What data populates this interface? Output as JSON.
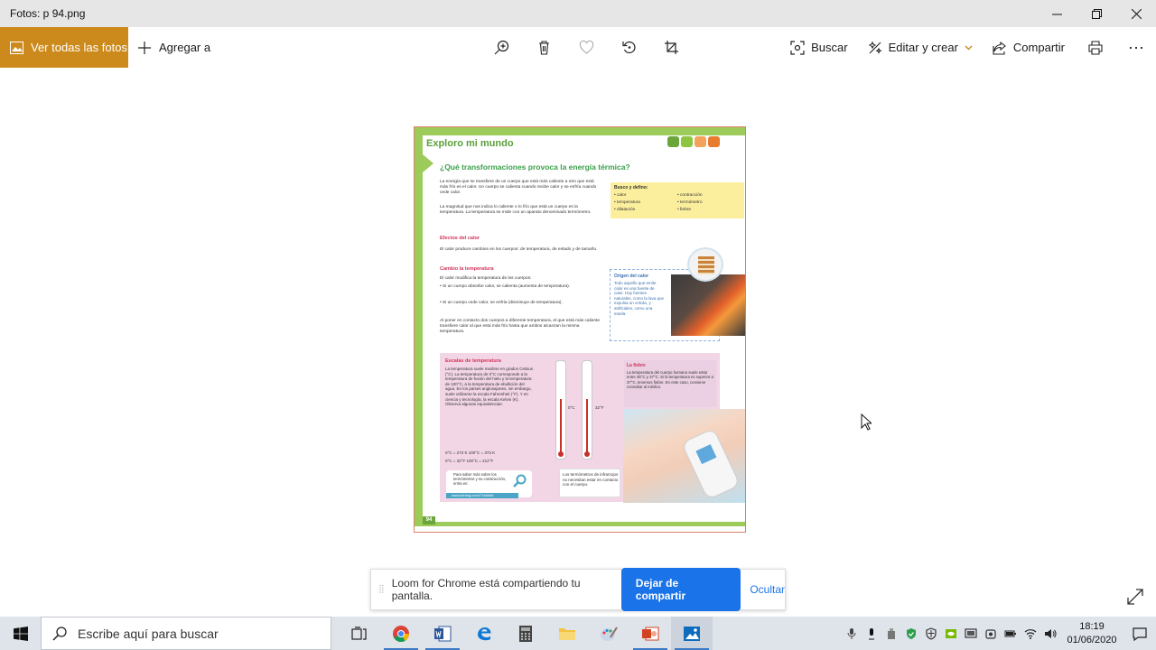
{
  "window": {
    "title": "Fotos: p 94.png"
  },
  "commandbar": {
    "view_all_label": "Ver todas las fotos",
    "add_to_label": "Agregar a",
    "search_label": "Buscar",
    "edit_create_label": "Editar y crear",
    "share_label": "Compartir"
  },
  "page": {
    "section_title": "Exploro mi mundo",
    "question": "¿Qué transformaciones provoca la energía térmica?",
    "intro_paragraph": "La energía que se transfiere de un cuerpo que está más caliente a otro que está más frío es el calor. Un cuerpo se calienta cuando recibe calor y se enfría cuando cede calor.",
    "temperature_paragraph": "La magnitud que nos indica lo caliente o lo frío que está un cuerpo es la temperatura. La temperatura se mide con un aparato denominado termómetro.",
    "effects_heading": "Efectos del calor",
    "effects_paragraph": "El calor produce cambios en los cuerpos: de temperatura, de estado y de tamaño.",
    "change_heading": "Cambio la temperatura",
    "change_paragraph": "El calor modifica la temperatura de los cuerpos:",
    "bullet_1": "• Si un cuerpo absorbe calor, se calienta (aumenta de temperatura).",
    "bullet_2": "• Si un cuerpo cede calor, se enfría (disminuye de temperatura).",
    "contact_paragraph": "Al poner en contacto dos cuerpos a diferente temperatura, el que está más caliente transfiere calor al que está más frío hasta que ambos alcanzan la misma temperatura.",
    "define_box_title": "Busco y defino:",
    "define_col1": [
      "• calor",
      "• temperatura",
      "• dilatación"
    ],
    "define_col2": [
      "• contracción",
      "• termómetro",
      "• fiebre"
    ],
    "origin_title": "Origen del calor",
    "origin_text": "Todo aquello que emite calor es una fuente de calor. Hay fuentes naturales, como la lava que expulsa un volcán, y artificiales, como una estufa.",
    "scales_heading": "Escalas de temperatura",
    "scales_text": "La temperatura suele medirse en grados Celsius (°C). La temperatura de 0°C corresponde a la temperatura de fusión del hielo y la temperatura de 100°C, a la temperatura de ebullición del agua. En los países anglosajones, sin embargo, suele utilizarse la escala Fahrenheit (°F). Y en ciencia y tecnología, la escala Kelvin (K). Observa algunas equivalencias:",
    "equivalences_1": "0°C = 273 K      100°C = 373 K",
    "equivalences_2": "0°C = 32°F       100°C = 212°F",
    "thermo_label_c": "0°C",
    "thermo_label_f": "32°F",
    "fever_title": "La fiebre",
    "fever_text": "La temperatura del cuerpo humano suele estar entre 36°C y 37°C. Si la temperatura es superior a 37°C, tenemos fiebre. En este caso, conviene consultar al médico.",
    "link_text": "Para saber más sobre los termómetros y su construcción, entra en:",
    "link_url": "www.tiching.com/7?#####",
    "note_text": "Los termómetros de infrarrojos no necesitan estar en contacto con el cuerpo.",
    "page_number": "94"
  },
  "toast": {
    "message": "Loom for Chrome está compartiendo tu pantalla.",
    "stop_label": "Dejar de compartir",
    "hide_label": "Ocultar"
  },
  "taskbar": {
    "search_placeholder": "Escribe aquí para buscar",
    "time": "18:19",
    "date": "01/06/2020"
  },
  "colors": {
    "accent": "#cd8a1c",
    "loom_blue": "#1a73e8",
    "page_green": "#9ccb5a"
  }
}
